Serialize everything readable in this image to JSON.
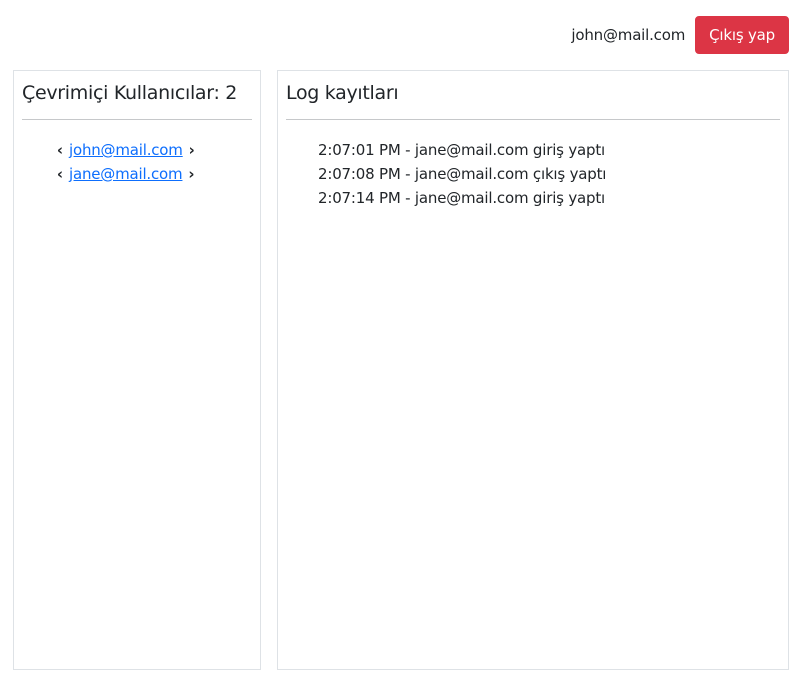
{
  "header": {
    "user_email": "john@mail.com",
    "logout_label": "Çıkış yap",
    "logout_color": "#dc3545"
  },
  "users_panel": {
    "title": "Çevrimiçi Kullanıcılar: 2",
    "users": [
      {
        "email": "john@mail.com",
        "left_icon": "chevron-left-icon",
        "right_icon": "chevron-right-icon"
      },
      {
        "email": "jane@mail.com",
        "left_icon": "chevron-left-icon",
        "right_icon": "chevron-right-icon"
      }
    ]
  },
  "logs_panel": {
    "title": "Log kayıtları",
    "entries": [
      "2:07:01 PM - jane@mail.com giriş yaptı",
      "2:07:08 PM - jane@mail.com çıkış yaptı",
      "2:07:14 PM - jane@mail.com giriş yaptı"
    ]
  },
  "colors": {
    "link": "#0d6efd",
    "border": "#dee2e6",
    "text": "#212529"
  }
}
